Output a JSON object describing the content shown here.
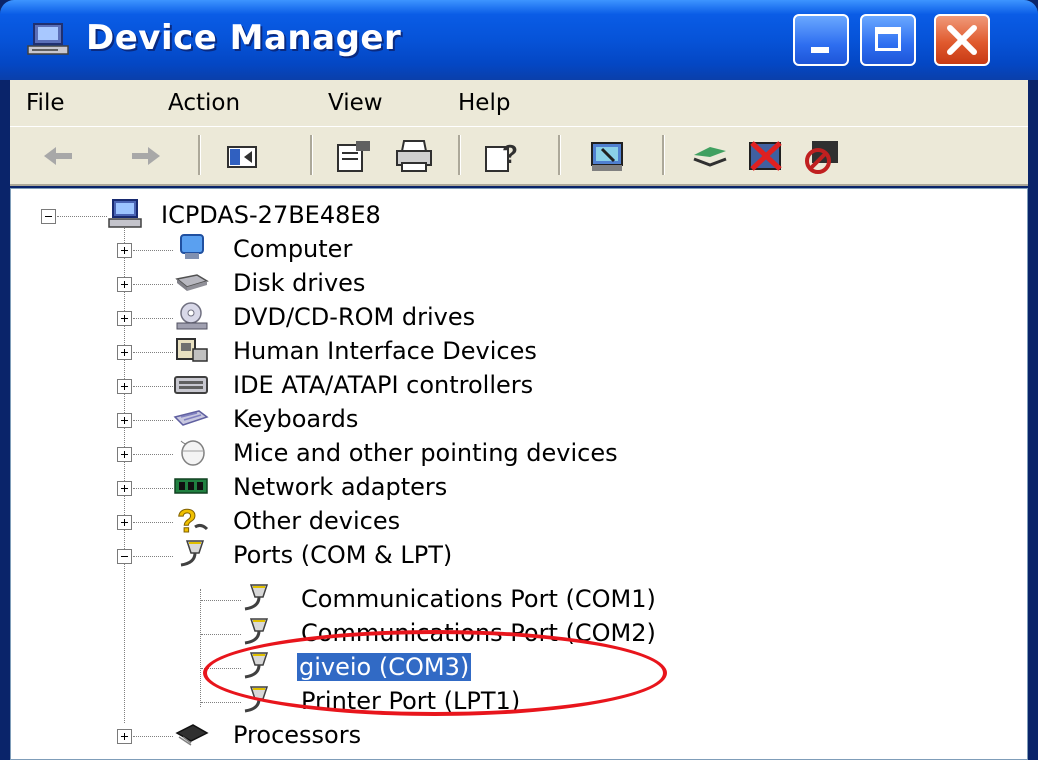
{
  "window": {
    "title": "Device Manager",
    "controls": [
      "minimize",
      "maximize",
      "close"
    ]
  },
  "menu": {
    "items": [
      "File",
      "Action",
      "View",
      "Help"
    ]
  },
  "toolbar": {
    "icons": [
      "back-icon",
      "forward-icon",
      "show-hide-tree-icon",
      "properties-icon",
      "print-icon",
      "help-icon",
      "scan-hardware-icon",
      "update-driver-icon",
      "uninstall-icon",
      "disable-icon"
    ]
  },
  "tree": {
    "root": "ICPDAS-27BE48E8",
    "categories": [
      {
        "label": "Computer",
        "icon": "computer-icon",
        "expanded": false
      },
      {
        "label": "Disk drives",
        "icon": "disk-drive-icon",
        "expanded": false
      },
      {
        "label": "DVD/CD-ROM drives",
        "icon": "dvd-icon",
        "expanded": false
      },
      {
        "label": "Human Interface Devices",
        "icon": "hid-icon",
        "expanded": false
      },
      {
        "label": "IDE ATA/ATAPI controllers",
        "icon": "ide-controller-icon",
        "expanded": false
      },
      {
        "label": "Keyboards",
        "icon": "keyboard-icon",
        "expanded": false
      },
      {
        "label": "Mice and other pointing devices",
        "icon": "mouse-icon",
        "expanded": false
      },
      {
        "label": "Network adapters",
        "icon": "network-adapter-icon",
        "expanded": false
      },
      {
        "label": "Other devices",
        "icon": "unknown-device-icon",
        "expanded": false
      },
      {
        "label": "Ports (COM & LPT)",
        "icon": "port-icon",
        "expanded": true
      },
      {
        "label": "Processors",
        "icon": "processor-icon",
        "expanded": false
      }
    ],
    "ports": [
      {
        "label": "Communications Port (COM1)",
        "selected": false
      },
      {
        "label": "Communications Port (COM2)",
        "selected": false
      },
      {
        "label": "giveio (COM3)",
        "selected": true
      },
      {
        "label": "Printer Port (LPT1)",
        "selected": false
      }
    ]
  },
  "annotation": {
    "color": "#e8151c",
    "target": "giveio (COM3)"
  },
  "colors": {
    "titlebar": "#0653d8",
    "selection": "#316ac5",
    "chrome": "#ece9d8"
  }
}
